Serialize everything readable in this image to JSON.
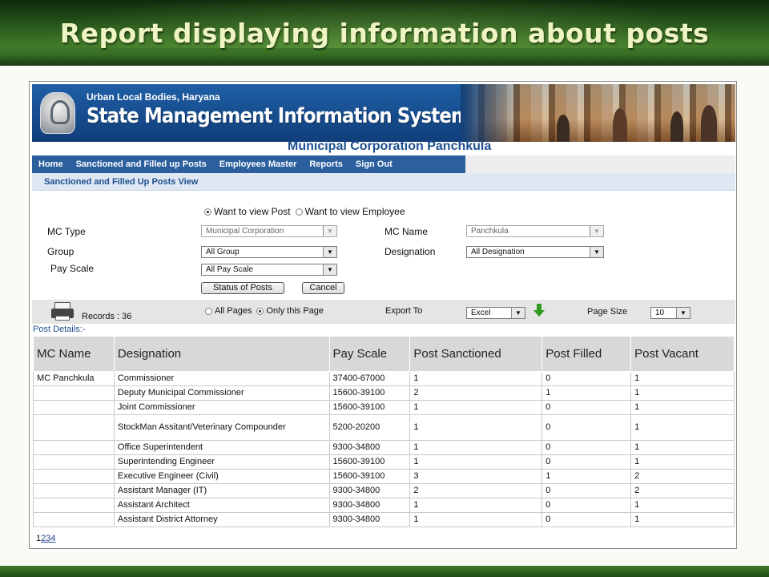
{
  "slide": {
    "title": "Report displaying information about posts"
  },
  "app": {
    "subtitle": "Urban Local Bodies, Haryana",
    "title": "State Management Information System",
    "corporation": "Municipal Corporation Panchkula"
  },
  "nav": {
    "items": [
      "Home",
      "Sanctioned and Filled up Posts",
      "Employees Master",
      "Reports",
      "Sign Out"
    ]
  },
  "subheader": "Sanctioned and Filled Up Posts View",
  "view_options": {
    "post_label": "Want to view Post",
    "employee_label": "Want to view Employee",
    "selected": "post"
  },
  "filters": {
    "mc_type": {
      "label": "MC Type",
      "value": "Municipal Corporation"
    },
    "mc_name": {
      "label": "MC Name",
      "value": "Panchkula"
    },
    "group": {
      "label": "Group",
      "value": "All Group"
    },
    "designation": {
      "label": "Designation",
      "value": "All Designation"
    },
    "pay_scale": {
      "label": "Pay Scale",
      "value": "All Pay Scale"
    }
  },
  "buttons": {
    "status": "Status of Posts",
    "cancel": "Cancel"
  },
  "toolbar": {
    "records": "Records : 36",
    "all_pages": "All Pages",
    "only_this_page": "Only this Page",
    "export_label": "Export To",
    "export_value": "Excel",
    "page_size_label": "Page Size",
    "page_size_value": "10"
  },
  "table": {
    "caption": "Post Details:-",
    "headers": [
      "MC Name",
      "Designation",
      "Pay Scale",
      "Post Sanctioned",
      "Post Filled",
      "Post Vacant"
    ],
    "rows": [
      [
        "MC Panchkula",
        "Commissioner",
        "37400-67000",
        "1",
        "0",
        "1"
      ],
      [
        "",
        "Deputy Municipal Commissioner",
        "15600-39100",
        "2",
        "1",
        "1"
      ],
      [
        "",
        "Joint Commissioner",
        "15600-39100",
        "1",
        "0",
        "1"
      ],
      [
        "",
        "StockMan Assitant/Veterinary Compounder",
        "5200-20200",
        "1",
        "0",
        "1"
      ],
      [
        "",
        "Office Superintendent",
        "9300-34800",
        "1",
        "0",
        "1"
      ],
      [
        "",
        "Superintending Engineer",
        "15600-39100",
        "1",
        "0",
        "1"
      ],
      [
        "",
        "Executive Engineer (Civil)",
        "15600-39100",
        "3",
        "1",
        "2"
      ],
      [
        "",
        "Assistant Manager (IT)",
        "9300-34800",
        "2",
        "0",
        "2"
      ],
      [
        "",
        "Assistant Architect",
        "9300-34800",
        "1",
        "0",
        "1"
      ],
      [
        "",
        "Assistant District Attorney",
        "9300-34800",
        "1",
        "0",
        "1"
      ]
    ]
  },
  "pager": {
    "pages": [
      "1",
      "2",
      "3",
      "4"
    ],
    "current": "1"
  }
}
